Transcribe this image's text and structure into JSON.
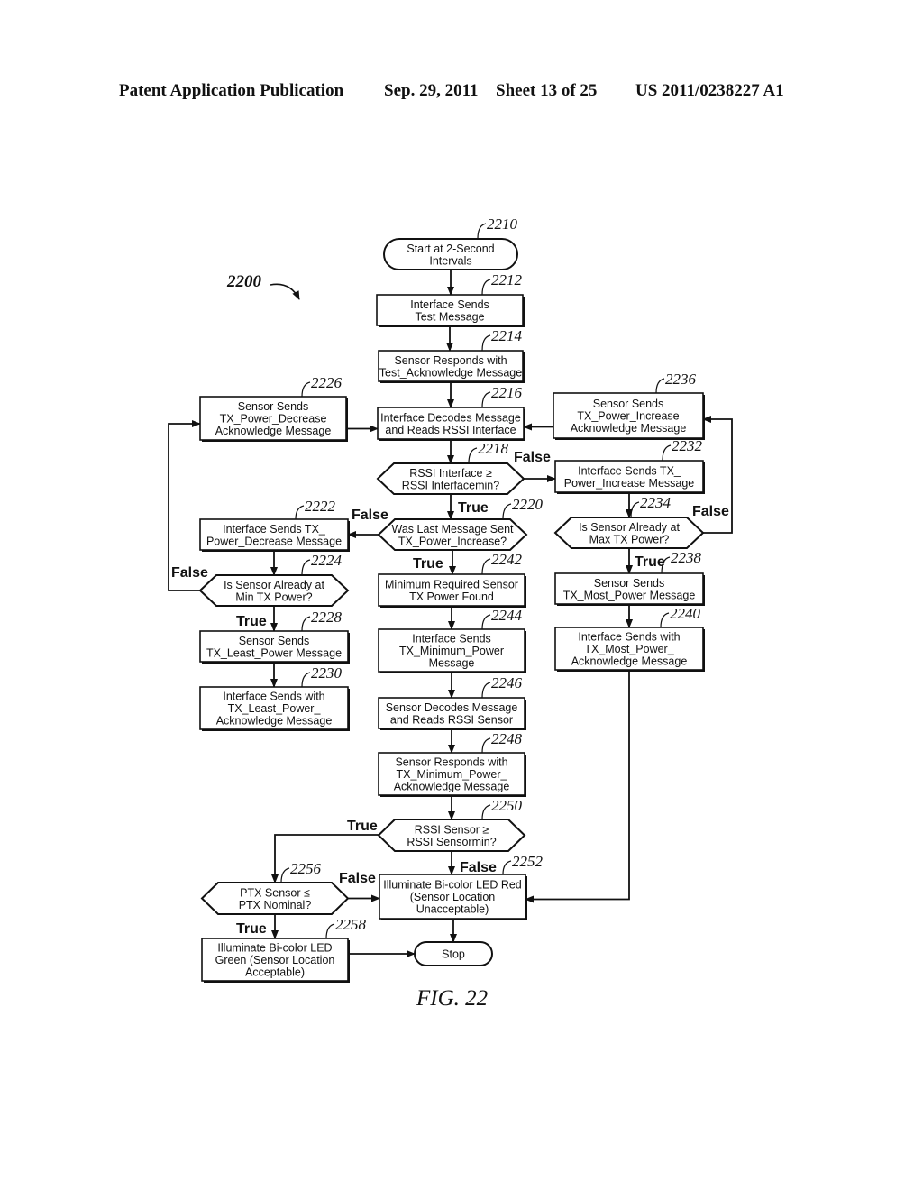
{
  "header": {
    "publication": "Patent Application Publication",
    "date": "Sep. 29, 2011",
    "sheet": "Sheet 13 of 25",
    "number": "US 2011/0238227 A1"
  },
  "figure": {
    "label": "FIG. 22",
    "ref": "2200"
  },
  "nodes": [
    {
      "id": "2210",
      "shape": "terminal",
      "lines": [
        "Start at 2-Second",
        "Intervals"
      ]
    },
    {
      "id": "2212",
      "shape": "process",
      "lines": [
        "Interface Sends",
        "Test Message"
      ]
    },
    {
      "id": "2214",
      "shape": "process",
      "lines": [
        "Sensor Responds with",
        "Test_Acknowledge Message"
      ]
    },
    {
      "id": "2216",
      "shape": "process",
      "lines": [
        "Interface Decodes Message",
        "and Reads RSSI Interface"
      ]
    },
    {
      "id": "2226",
      "shape": "process",
      "lines": [
        "Sensor Sends",
        "TX_Power_Decrease",
        "Acknowledge Message"
      ]
    },
    {
      "id": "2236",
      "shape": "process",
      "lines": [
        "Sensor Sends",
        "TX_Power_Increase",
        "Acknowledge Message"
      ]
    },
    {
      "id": "2218",
      "shape": "decision",
      "lines": [
        "RSSI Interface ≥",
        "RSSI Interfacemin?"
      ]
    },
    {
      "id": "2232",
      "shape": "process",
      "lines": [
        "Interface Sends TX_",
        "Power_Increase Message"
      ]
    },
    {
      "id": "2220",
      "shape": "decision",
      "lines": [
        "Was Last Message Sent",
        "TX_Power_Increase?"
      ]
    },
    {
      "id": "2222",
      "shape": "process",
      "lines": [
        "Interface Sends TX_",
        "Power_Decrease Message"
      ]
    },
    {
      "id": "2234",
      "shape": "decision",
      "lines": [
        "Is Sensor Already at",
        "Max TX Power?"
      ]
    },
    {
      "id": "2224",
      "shape": "decision",
      "lines": [
        "Is Sensor Already at",
        "Min TX Power?"
      ]
    },
    {
      "id": "2242",
      "shape": "process",
      "lines": [
        "Minimum Required Sensor",
        "TX Power Found"
      ]
    },
    {
      "id": "2238",
      "shape": "process",
      "lines": [
        "Sensor Sends",
        "TX_Most_Power Message"
      ]
    },
    {
      "id": "2228",
      "shape": "process",
      "lines": [
        "Sensor Sends",
        "TX_Least_Power Message"
      ]
    },
    {
      "id": "2244",
      "shape": "process",
      "lines": [
        "Interface Sends",
        "TX_Minimum_Power",
        "Message"
      ]
    },
    {
      "id": "2240",
      "shape": "process",
      "lines": [
        "Interface Sends with",
        "TX_Most_Power_",
        "Acknowledge Message"
      ]
    },
    {
      "id": "2230",
      "shape": "process",
      "lines": [
        "Interface Sends with",
        "TX_Least_Power_",
        "Acknowledge Message"
      ]
    },
    {
      "id": "2246",
      "shape": "process",
      "lines": [
        "Sensor Decodes Message",
        "and Reads RSSI Sensor"
      ]
    },
    {
      "id": "2248",
      "shape": "process",
      "lines": [
        "Sensor Responds with",
        "TX_Minimum_Power_",
        "Acknowledge Message"
      ]
    },
    {
      "id": "2250",
      "shape": "decision",
      "lines": [
        "RSSI Sensor ≥",
        "RSSI Sensormin?"
      ]
    },
    {
      "id": "2256",
      "shape": "decision",
      "lines": [
        "PTX Sensor ≤",
        "PTX Nominal?"
      ]
    },
    {
      "id": "2252",
      "shape": "process",
      "lines": [
        "Illuminate Bi-color LED Red",
        "(Sensor Location",
        "Unacceptable)"
      ]
    },
    {
      "id": "2258",
      "shape": "process",
      "lines": [
        "Illuminate Bi-color LED",
        "Green (Sensor Location",
        "Acceptable)"
      ]
    },
    {
      "id": "stop",
      "shape": "terminal",
      "lines": [
        "Stop"
      ]
    }
  ],
  "edges": [
    {
      "from": "2210",
      "to": "2212",
      "label": ""
    },
    {
      "from": "2212",
      "to": "2214",
      "label": ""
    },
    {
      "from": "2214",
      "to": "2216",
      "label": ""
    },
    {
      "from": "2216",
      "to": "2218",
      "label": ""
    },
    {
      "from": "2218",
      "to": "2232",
      "label": "False"
    },
    {
      "from": "2218",
      "to": "2220",
      "label": "True"
    },
    {
      "from": "2220",
      "to": "2222",
      "label": "False"
    },
    {
      "from": "2220",
      "to": "2242",
      "label": "True"
    },
    {
      "from": "2222",
      "to": "2224",
      "label": ""
    },
    {
      "from": "2224",
      "to": "2226",
      "label": "False"
    },
    {
      "from": "2224",
      "to": "2228",
      "label": "True"
    },
    {
      "from": "2226",
      "to": "2216",
      "label": ""
    },
    {
      "from": "2228",
      "to": "2230",
      "label": ""
    },
    {
      "from": "2232",
      "to": "2234",
      "label": ""
    },
    {
      "from": "2234",
      "to": "2236",
      "label": "False"
    },
    {
      "from": "2234",
      "to": "2238",
      "label": "True"
    },
    {
      "from": "2236",
      "to": "2216",
      "label": ""
    },
    {
      "from": "2238",
      "to": "2240",
      "label": ""
    },
    {
      "from": "2240",
      "to": "2252",
      "label": ""
    },
    {
      "from": "2242",
      "to": "2244",
      "label": ""
    },
    {
      "from": "2244",
      "to": "2246",
      "label": ""
    },
    {
      "from": "2246",
      "to": "2248",
      "label": ""
    },
    {
      "from": "2248",
      "to": "2250",
      "label": ""
    },
    {
      "from": "2250",
      "to": "2256",
      "label": "True"
    },
    {
      "from": "2250",
      "to": "2252",
      "label": "False"
    },
    {
      "from": "2256",
      "to": "2252",
      "label": "False"
    },
    {
      "from": "2256",
      "to": "2258",
      "label": "True"
    },
    {
      "from": "2252",
      "to": "stop",
      "label": ""
    },
    {
      "from": "2258",
      "to": "stop",
      "label": ""
    }
  ]
}
